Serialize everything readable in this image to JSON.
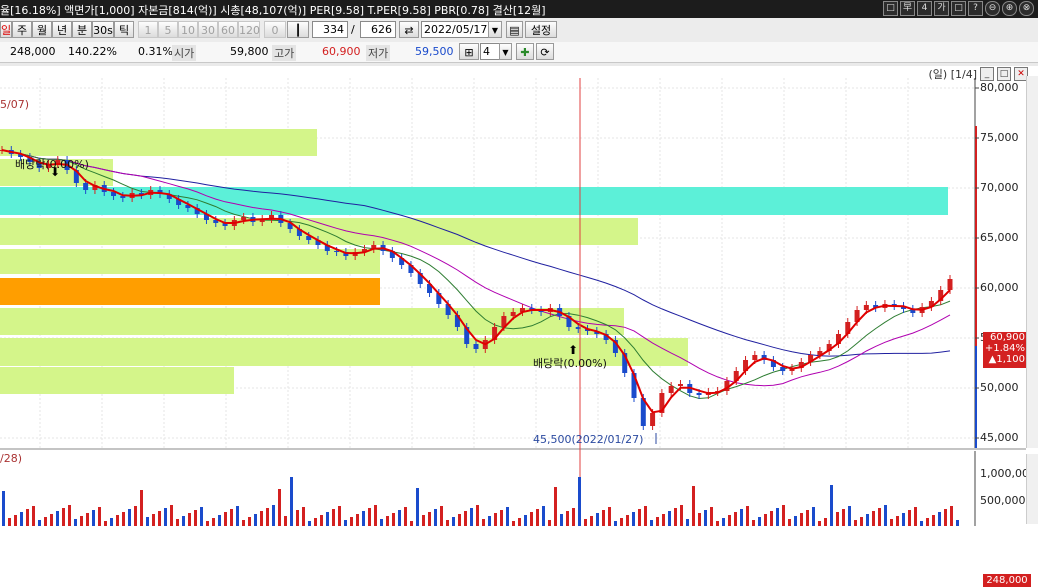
{
  "topbar": {
    "info": "율[16.18%] 액면가[1,000] 자본금[814(억)] 시총[48,107(억)] PER[9.58] T.PER[9.58] PBR[0.78] 결산[12월]",
    "win_buttons": [
      "□",
      "早",
      "4",
      "가",
      "□",
      "?"
    ]
  },
  "toolbar": {
    "period_buttons": [
      "일",
      "주",
      "월",
      "년",
      "분",
      "30s",
      "틱"
    ],
    "minute_buttons": [
      "1",
      "5",
      "10",
      "30",
      "60",
      "120"
    ],
    "zero_value": "0",
    "count_value": "334",
    "slash": "/",
    "total_value": "626",
    "date_value": "2022/05/17",
    "settings_label": "설정"
  },
  "infobar": {
    "volume": "248,000",
    "ratio": "140.22%",
    "change": "0.31%",
    "open_label": "시가",
    "open_value": "59,800",
    "high_label": "고가",
    "high_value": "60,900",
    "low_label": "저가",
    "low_value": "59,500",
    "grid_count": "4"
  },
  "chart_pane": {
    "header": "(일) [1/4]",
    "left_date_label": "5/07)",
    "vol_left_label": "/28)",
    "annotations": {
      "dividend1": "배당락(0.00%)",
      "dividend2": "배당락(0.00%)",
      "low_marker": "45,500(2022/01/27)"
    },
    "current_price_box": [
      "60,900",
      "+1.84%",
      "▲1,100"
    ],
    "volume_box": "248,000",
    "colors": {
      "up": "#d32020",
      "down": "#1a4bcc",
      "ma5": "#e00000",
      "ma20": "#2e7d32",
      "ma60": "#b000b0",
      "ma120": "#2020a0",
      "band_green": "#d4f58a",
      "band_cyan": "#5cf0d8",
      "band_orange": "#ff9e00"
    }
  },
  "chart_data": {
    "type": "line",
    "title": "",
    "ylabel": "",
    "y_ticks": [
      80000,
      75000,
      70000,
      65000,
      60000,
      55000,
      50000,
      45000
    ],
    "y_tick_labels": [
      "80,000",
      "75,000",
      "70,000",
      "65,000",
      "60,000",
      "55,000",
      "50,000",
      "45,000"
    ],
    "ylim": [
      44000,
      81000
    ],
    "volume_ticks": [
      "1,000,000",
      "500,000"
    ],
    "last": {
      "price": 60900,
      "change_pct": 1.84,
      "change": 1100,
      "volume": 248000
    },
    "low": {
      "price": 45500,
      "date": "2022/01/27"
    },
    "series": [
      {
        "name": "close",
        "values": [
          73800,
          73400,
          73100,
          72600,
          72000,
          72400,
          72800,
          71800,
          70500,
          69800,
          70300,
          69600,
          69200,
          69000,
          69500,
          69300,
          69800,
          69400,
          68900,
          68300,
          68000,
          67400,
          66800,
          66500,
          66200,
          66800,
          67100,
          66600,
          66900,
          67300,
          66500,
          65900,
          65200,
          64800,
          64300,
          63700,
          63600,
          63200,
          63600,
          63900,
          64300,
          63700,
          63000,
          62300,
          61500,
          60400,
          59500,
          58400,
          57300,
          56100,
          54400,
          53900,
          54800,
          56100,
          57200,
          57600,
          58000,
          57800,
          57600,
          58000,
          57200,
          56100,
          55900,
          55700,
          55400,
          54800,
          53500,
          51500,
          49000,
          46200,
          47500,
          49500,
          50200,
          50400,
          49500,
          49300,
          49600,
          49700,
          50700,
          51700,
          52800,
          53300,
          52800,
          52100,
          51700,
          52000,
          52600,
          53300,
          53700,
          54400,
          55400,
          56600,
          57800,
          58300,
          58000,
          58400,
          58200,
          57900,
          57500,
          58100,
          58700,
          59800,
          60900
        ]
      }
    ]
  }
}
